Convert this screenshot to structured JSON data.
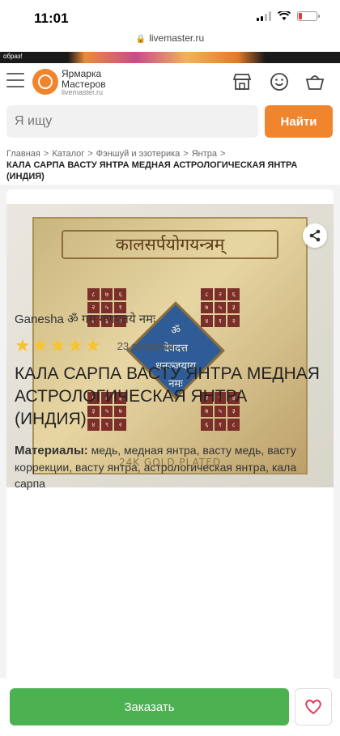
{
  "status_bar": {
    "time": "11:01"
  },
  "browser": {
    "url": "livemaster.ru"
  },
  "promo": {
    "text": "образ!"
  },
  "header": {
    "logo_line1": "Ярмарка",
    "logo_line2": "Мастеров",
    "logo_domain": "livemaster.ru",
    "icons": [
      "menu-icon",
      "shop-icon",
      "smile-icon",
      "basket-icon"
    ]
  },
  "search": {
    "placeholder": "Я ищу",
    "button_label": "Найти"
  },
  "breadcrumb": {
    "items": [
      "Главная",
      "Каталог",
      "Фэншуй и эзотерика",
      "Янтра"
    ],
    "current": "КАЛА САРПА ВАСТУ ЯНТРА МЕДНАЯ АСТРОЛОГИЧЕСКАЯ ЯНТРА (ИНДИЯ)"
  },
  "product_image": {
    "yantra_title": "कालसर्पयोगयन्त्रम्",
    "center_text_1": "ॐ",
    "center_text_2": "देवदत्त",
    "center_text_3": "धनञ्जयाय",
    "center_text_4": "नमः",
    "footer": "24K GOLD PLATED",
    "grid_tl": [
      "८",
      "७",
      "६",
      "२",
      "५",
      "१",
      "४",
      "३",
      "२"
    ],
    "grid_tr": [
      "८",
      "२",
      "६",
      "७",
      "५",
      "३",
      "४",
      "१",
      "२"
    ],
    "grid_bl": [
      "१",
      "८",
      "३",
      "३",
      "५",
      "७",
      "४",
      "९",
      "२"
    ],
    "grid_br": [
      "२",
      "९",
      "४",
      "७",
      "५",
      "३",
      "६",
      "१",
      "८"
    ]
  },
  "product": {
    "seller": "Ganesha ॐ गम गणपतये नमः",
    "rating_stars": 5,
    "sales": "23 продажи",
    "title": "КАЛА САРПА ВАСТУ ЯНТРА МЕДНАЯ АСТРОЛОГИЧЕСКАЯ ЯНТРА (ИНДИЯ)",
    "materials_label": "Материалы:",
    "materials_value": "медь, медная янтра, васту медь, васту коррекции, васту янтра, астрологическая янтра, кала сарпа"
  },
  "actions": {
    "order_label": "Заказать"
  },
  "colors": {
    "accent": "#f0852d",
    "order": "#4cb151",
    "star": "#f7c32e",
    "heart": "#e23a5a"
  }
}
